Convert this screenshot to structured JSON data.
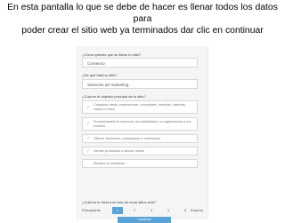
{
  "caption": {
    "line1": "En esta pantalla lo que se debe de hacer es llenar todos los datos para",
    "line2": "poder crear el sitio web ya terminados dar clic en continuar"
  },
  "form": {
    "q1": {
      "label": "¿Cómo quieres que se llame tu sitio?",
      "value": "Comercio"
    },
    "q2": {
      "label": "¿De qué trata tu sitio?",
      "value": "Servicios de marketing"
    },
    "q3": {
      "label": "¿Cuál es el objetivo principal de tu sitio?",
      "options": [
        {
          "text": "Compartir ideas, experiencias, novedades, reseñas, historias, vídeos o fotos",
          "checked": true
        },
        {
          "text": "Promocionarte tu empresa, tus habilidades, tu organización o tus eventos",
          "checked": true
        },
        {
          "text": "Ofrecer formación, preparación u orientación",
          "checked": true
        },
        {
          "text": "Vender productos u ofrecer online",
          "checked": true
        },
        {
          "text": "Muestra su portafolio",
          "checked": false
        }
      ]
    },
    "q4": {
      "label": "¿Cuál es tu nivel a la hora de crear sitios web?",
      "start": "Principiante",
      "end": "Experto",
      "levels": [
        "1",
        "2",
        "3",
        "4",
        "5"
      ],
      "selected": "1"
    },
    "continue_label": "Continuar"
  },
  "colors": {
    "accent": "#5aa3d8",
    "panel": "#f5f5f5"
  }
}
